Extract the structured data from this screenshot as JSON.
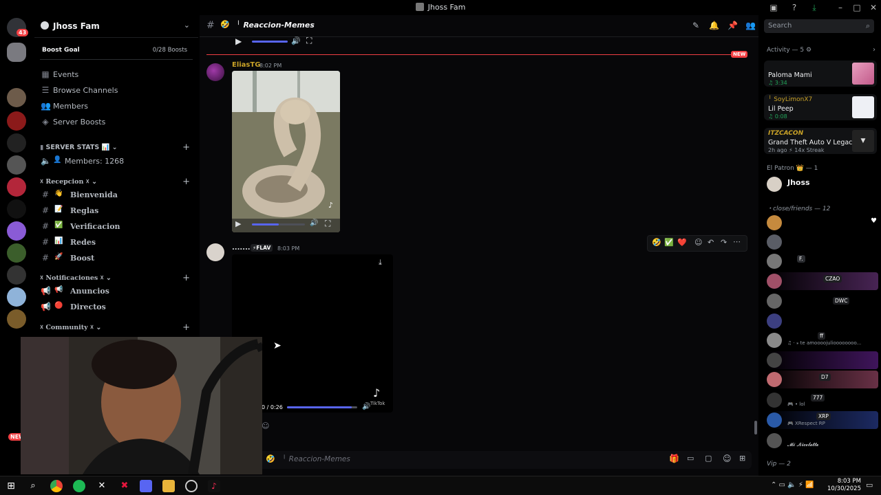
{
  "window": {
    "title": "Jhoss Fam"
  },
  "rail": {
    "home_badge": "43",
    "new_badge": "NEW"
  },
  "server": {
    "name": "Jhoss Fam",
    "boost_goal_label": "Boost Goal",
    "boost_goal_value": "0/28 Boosts",
    "nav": [
      "Events",
      "Browse Channels",
      "Members",
      "Server Boosts"
    ],
    "categories": [
      {
        "label": "SERVER STATS 📊",
        "channels": [
          {
            "name": "Members: 1268",
            "prefix": "🔈 👤 ╵"
          }
        ]
      },
      {
        "label": "☓ Recepcion ☓",
        "channels": [
          {
            "name": "Bienvenida",
            "emoji": "👋"
          },
          {
            "name": "Reglas",
            "emoji": "📝"
          },
          {
            "name": "Verificacion",
            "emoji": "✅"
          },
          {
            "name": "Redes",
            "emoji": "📊"
          },
          {
            "name": "Boost",
            "emoji": "🚀"
          }
        ]
      },
      {
        "label": "☓ Notificaciones ☓",
        "channels": [
          {
            "name": "Anuncios",
            "emoji": "📢"
          },
          {
            "name": "Directos",
            "emoji": "🔴"
          }
        ]
      },
      {
        "label": "☓ Community ☓",
        "channels": []
      }
    ]
  },
  "chat": {
    "channel_name": "╵ Reaccion-Memes",
    "new_label": "NEW",
    "search_placeholder": "Search",
    "messages": [
      {
        "author": "EliasTG",
        "time": "8:02 PM",
        "author_color": "#c9a227"
      },
      {
        "author": "..........",
        "role_tag": "⚡FLAV",
        "time": "8:03 PM",
        "video_time": "0 / 0:26"
      }
    ],
    "tiktok_label": "TikTok",
    "reactions": [
      "🤣",
      "✅",
      "❤️"
    ],
    "composer_placeholder": "╵ Reaccion-Memes"
  },
  "members": {
    "activity_header": "Activity — 5 ⚙",
    "activities": [
      {
        "user": "",
        "title": "Paloma Mami",
        "meta": "♫ 3:34"
      },
      {
        "user": "╵ SoyLimonX7",
        "title": "Lil Peep",
        "meta": "♫ 0:08"
      },
      {
        "user": "ITZCACON",
        "title": "Grand Theft Auto V Legacy",
        "meta": "2h ago ⚡ 14x Streak"
      }
    ],
    "group1": "El Patron 👑 — 1",
    "owner": "Jhoss",
    "group2": "・close/friends — 12",
    "tags": [
      "F.",
      "CZAO",
      "DWC",
      "ff",
      "D7",
      "777",
      "XRP"
    ],
    "subtexts": [
      "♫ · ⁎ te amoooojulioooooooo...",
      "🎮 • lol",
      "🎮 XRespect RP",
      "𝓜𝓲 𝓝𝓲𝓬𝓸𝓵𝓮𝓽𝓽𝓮"
    ],
    "group3": "Vip — 2"
  },
  "taskbar": {
    "time": "8:03 PM",
    "date": "10/30/2025"
  },
  "colors": {
    "accent": "#5865f2",
    "new_red": "#f23f43",
    "green": "#23a55a"
  }
}
